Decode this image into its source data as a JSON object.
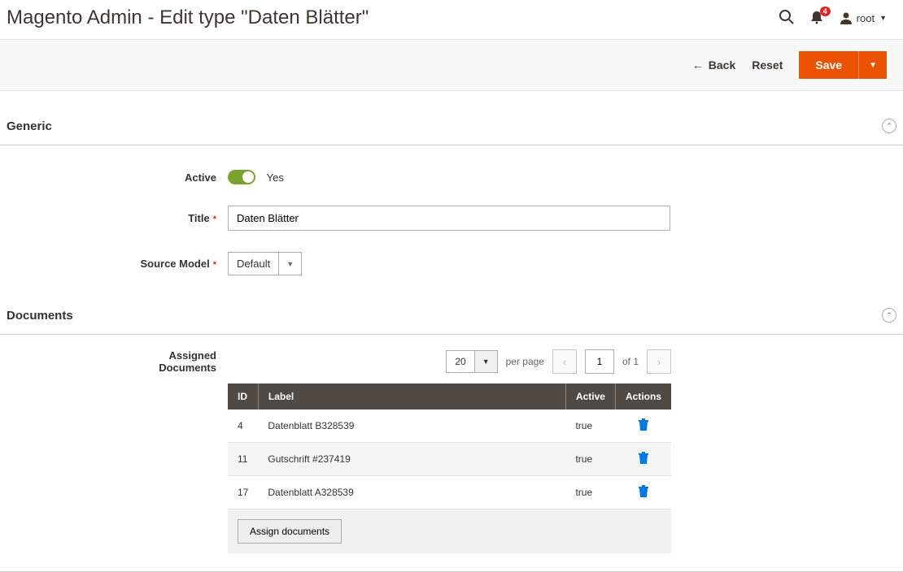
{
  "header": {
    "title": "Magento Admin - Edit type \"Daten Blätter\"",
    "notification_count": "4",
    "user_name": "root"
  },
  "actions": {
    "back": "Back",
    "reset": "Reset",
    "save": "Save"
  },
  "sections": {
    "generic": {
      "title": "Generic",
      "fields": {
        "active_label": "Active",
        "active_value": "Yes",
        "title_label": "Title",
        "title_value": "Daten Blätter",
        "source_model_label": "Source Model",
        "source_model_value": "Default"
      }
    },
    "documents": {
      "title": "Documents",
      "assigned_label": "Assigned Documents",
      "pager": {
        "per_page_value": "20",
        "per_page_text": "per page",
        "current_page": "1",
        "of_text": "of 1"
      },
      "columns": {
        "id": "ID",
        "label": "Label",
        "active": "Active",
        "actions": "Actions"
      },
      "rows": [
        {
          "id": "4",
          "label": "Datenblatt B328539",
          "active": "true"
        },
        {
          "id": "11",
          "label": "Gutschrift #237419",
          "active": "true"
        },
        {
          "id": "17",
          "label": "Datenblatt A328539",
          "active": "true"
        }
      ],
      "assign_button": "Assign documents"
    }
  }
}
